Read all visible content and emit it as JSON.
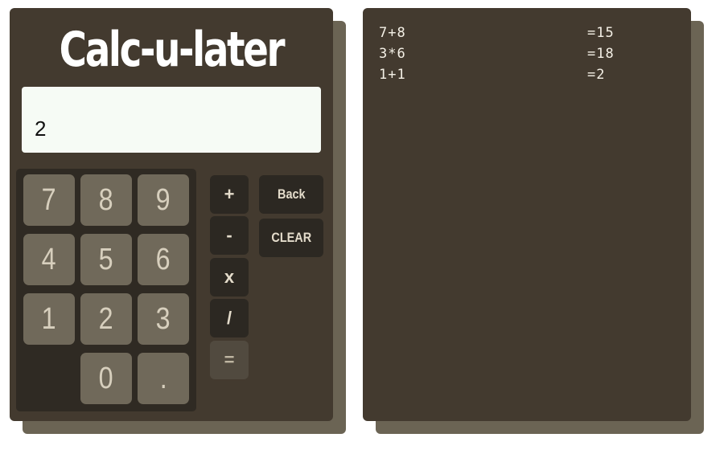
{
  "calculator": {
    "title": "Calc-u-later",
    "display_value": "2",
    "keys": [
      "7",
      "8",
      "9",
      "4",
      "5",
      "6",
      "1",
      "2",
      "3",
      "0",
      "."
    ],
    "operators": [
      "+",
      "-",
      "x",
      "/",
      "="
    ],
    "back_label": "Back",
    "clear_label": "CLEAR"
  },
  "history": {
    "entries": [
      {
        "expression": "7+8",
        "result": "=15"
      },
      {
        "expression": "3*6",
        "result": "=18"
      },
      {
        "expression": "1+1",
        "result": "=2"
      }
    ]
  },
  "colors": {
    "panel": "#433a2f",
    "shadow": "#6b6454",
    "display": "#f6fbf5",
    "key": "#70695a",
    "operator": "#2c2822"
  }
}
